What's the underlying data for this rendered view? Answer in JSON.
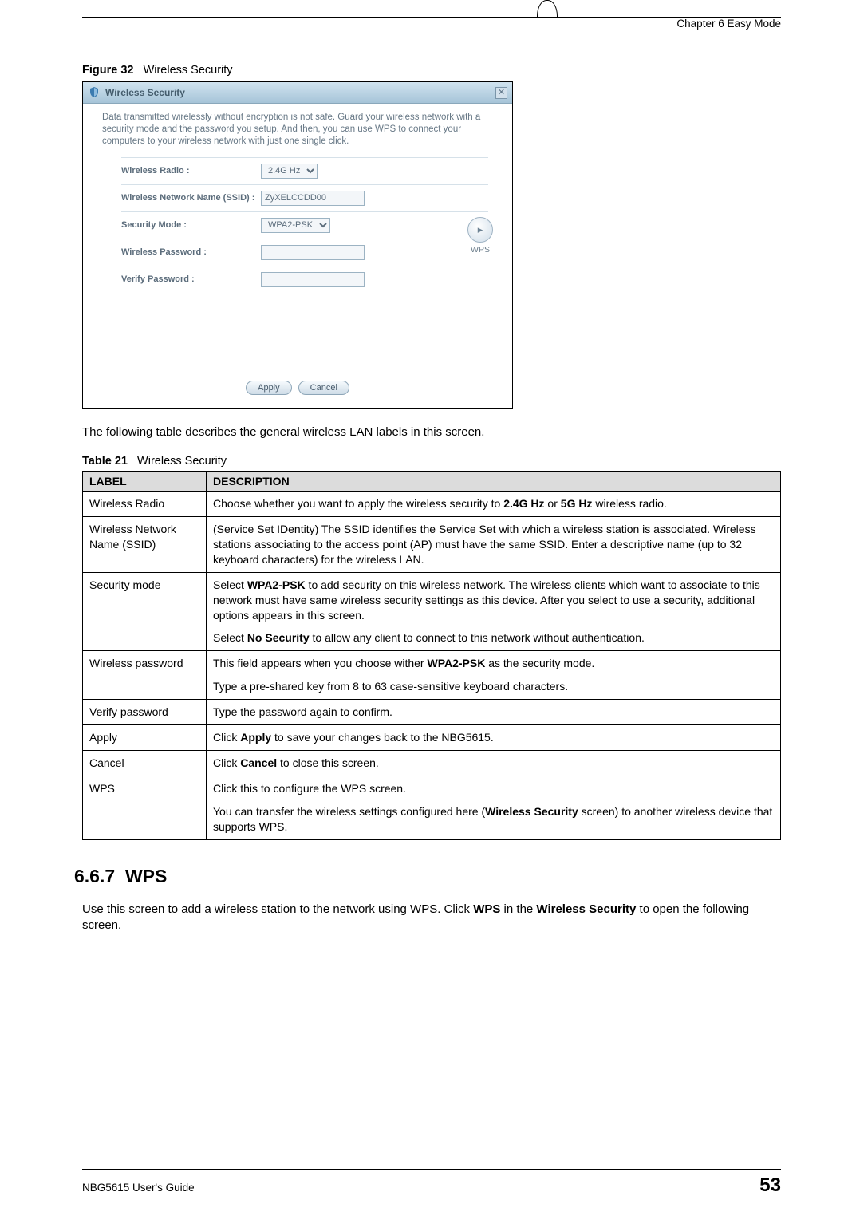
{
  "header": {
    "chapter": "Chapter 6 Easy Mode"
  },
  "figure": {
    "label": "Figure 32",
    "title": "Wireless Security"
  },
  "dialog": {
    "title": "Wireless Security",
    "intro": "Data transmitted wirelessly without encryption is not safe. Guard your wireless network with a security mode and the password you setup. And then, you can use WPS to connect your computers to your wireless network with just one single click.",
    "rows": {
      "radio": {
        "label": "Wireless Radio :",
        "value": "2.4G Hz"
      },
      "ssid": {
        "label": "Wireless Network Name (SSID) :",
        "value": "ZyXELCCDD00"
      },
      "mode": {
        "label": "Security Mode :",
        "value": "WPA2-PSK"
      },
      "pwd": {
        "label": "Wireless Password :",
        "value": ""
      },
      "vpwd": {
        "label": "Verify Password :",
        "value": ""
      }
    },
    "wps_label": "WPS",
    "buttons": {
      "apply": "Apply",
      "cancel": "Cancel"
    }
  },
  "intro_para": "The following table describes the general wireless LAN labels in this screen.",
  "table": {
    "label": "Table 21",
    "title": "Wireless Security",
    "head": {
      "c1": "LABEL",
      "c2": "DESCRIPTION"
    },
    "rows": [
      {
        "label": "Wireless Radio",
        "desc_parts": [
          "Choose whether you want to apply the wireless security to ",
          "2.4G Hz",
          " or ",
          "5G Hz",
          " wireless radio."
        ]
      },
      {
        "label": "Wireless Network Name (SSID)",
        "desc": "(Service Set IDentity) The SSID identifies the Service Set with which a wireless station is associated. Wireless stations associating to the access point (AP) must have the same SSID. Enter a descriptive name (up to 32 keyboard characters) for the wireless LAN."
      },
      {
        "label": "Security mode",
        "desc_p1": [
          "Select ",
          "WPA2-PSK",
          " to add security on this wireless network. The wireless clients which want to associate to this network must have same wireless security settings as this device. After you select to use a security, additional options appears in this screen."
        ],
        "desc_p2": [
          "Select ",
          "No Security",
          " to allow any client to connect to this network without authentication."
        ]
      },
      {
        "label": "Wireless password",
        "desc_p1": [
          "This field appears when you choose wither ",
          "WPA2-PSK",
          " as the security mode."
        ],
        "desc_p2_plain": "Type a pre-shared key from 8 to 63 case-sensitive keyboard characters."
      },
      {
        "label": "Verify password",
        "desc": "Type the password again to confirm."
      },
      {
        "label": "Apply",
        "desc_parts": [
          "Click ",
          "Apply",
          " to save your changes back to the NBG5615."
        ]
      },
      {
        "label": "Cancel",
        "desc_parts": [
          "Click ",
          "Cancel",
          " to close this screen."
        ]
      },
      {
        "label": "WPS",
        "desc_p1_plain": "Click this to configure the WPS screen.",
        "desc_p2": [
          "You can transfer the wireless settings configured here (",
          "Wireless Security",
          " screen) to another wireless device that supports WPS."
        ]
      }
    ]
  },
  "section": {
    "number": "6.6.7",
    "title": "WPS",
    "para_parts": [
      "Use this screen to add a wireless station to the network using WPS. Click ",
      "WPS",
      " in the ",
      "Wireless Security",
      " to open the following screen."
    ]
  },
  "footer": {
    "guide": "NBG5615 User's Guide",
    "page": "53"
  }
}
